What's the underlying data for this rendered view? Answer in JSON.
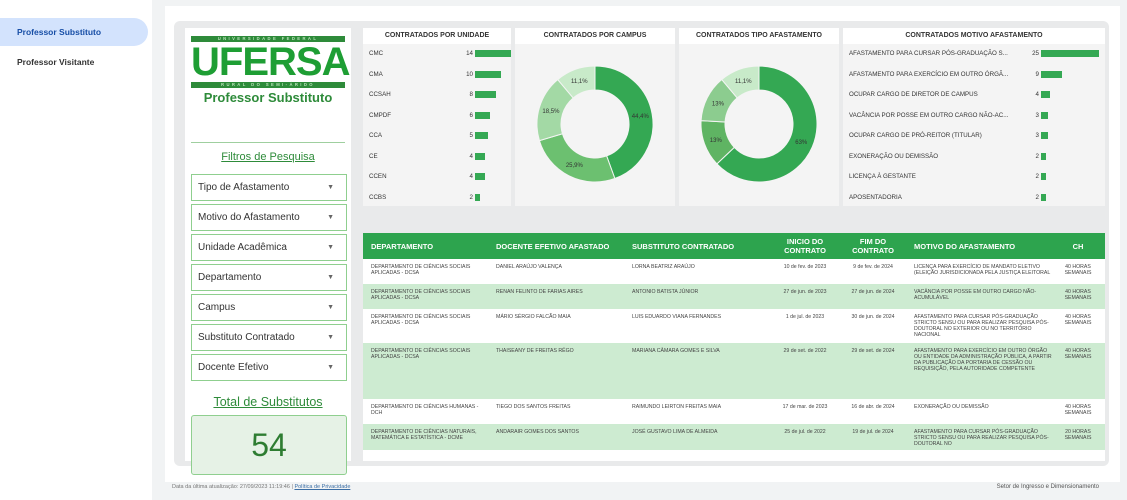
{
  "nav": {
    "items": [
      {
        "label": "Professor Substituto"
      },
      {
        "label": "Professor Visitante"
      }
    ]
  },
  "logo": {
    "top_band": "UNIVERSIDADE FEDERAL",
    "word": "UFERSA",
    "bottom_band": "RURAL DO SEMI-ÁRIDO"
  },
  "panel": {
    "title": "Professor Substituto",
    "filters_title": "Filtros de Pesquisa",
    "filters": [
      "Tipo de Afastamento",
      "Motivo do Afastamento",
      "Unidade Acadêmica",
      "Departamento",
      "Campus",
      "Substituto Contratado",
      "Docente Efetivo"
    ],
    "total_title": "Total de Substitutos",
    "total_value": "54"
  },
  "colors": {
    "accent": "#34a853",
    "header": "#2da44e",
    "row_alt": "#cdebd1"
  },
  "chart_data": [
    {
      "type": "bar",
      "title": "CONTRATADOS POR UNIDADE",
      "categories": [
        "CMC",
        "CMA",
        "CCSAH",
        "CMPDF",
        "CCA",
        "CE",
        "CCEN",
        "CCBS"
      ],
      "values": [
        14,
        10,
        8,
        6,
        5,
        4,
        4,
        2
      ]
    },
    {
      "type": "pie",
      "title": "CONTRATADOS POR CAMPUS",
      "values": [
        44.4,
        25.9,
        18.5,
        11.1
      ],
      "labels": [
        "44,4%",
        "25,9%",
        "18,5%",
        "11,1%"
      ],
      "colors": [
        "#34a853",
        "#6cc070",
        "#a3d9a5",
        "#c8eac9"
      ]
    },
    {
      "type": "pie",
      "title": "CONTRATADOS TIPO AFASTAMENTO",
      "values": [
        63,
        13,
        13,
        11.1
      ],
      "labels": [
        "63%",
        "13%",
        "13%",
        "11,1%"
      ],
      "colors": [
        "#34a853",
        "#5fb463",
        "#8ccc8f",
        "#c8eac9"
      ]
    },
    {
      "type": "bar",
      "title": "CONTRATADOS MOTIVO AFASTAMENTO",
      "categories": [
        "AFASTAMENTO PARA CURSAR PÓS-GRADUAÇÃO S...",
        "AFASTAMENTO PARA EXERCÍCIO EM OUTRO ÓRGÃ...",
        "OCUPAR CARGO DE DIRETOR DE CAMPUS",
        "VACÂNCIA POR POSSE EM OUTRO CARGO NÃO-AC...",
        "OCUPAR CARGO DE PRÓ-REITOR (TITULAR)",
        "EXONERAÇÃO OU DEMISSÃO",
        "LICENÇA À GESTANTE",
        "APOSENTADORIA"
      ],
      "values": [
        25,
        9,
        4,
        3,
        3,
        2,
        2,
        2
      ]
    }
  ],
  "table": {
    "headers": [
      "DEPARTAMENTO",
      "DOCENTE EFETIVO AFASTADO",
      "SUBSTITUTO CONTRATADO",
      "INICIO DO CONTRATO",
      "FIM DO CONTRATO",
      "MOTIVO DO AFASTAMENTO",
      "CH"
    ],
    "rows": [
      [
        "DEPARTAMENTO DE CIÊNCIAS SOCIAIS APLICADAS - DCSA",
        "DANIEL ARAÚJO VALENÇA",
        "LORNA BEATRIZ ARAÚJO",
        "10 de fev. de 2023",
        "9 de fev. de 2024",
        "LICENÇA PARA EXERCÍCIO DE MANDATO ELETIVO (ELEIÇÃO JURISDICIONADA PELA JUSTIÇA ELEITORAL",
        "40 HORAS SEMANAIS"
      ],
      [
        "DEPARTAMENTO DE CIÊNCIAS SOCIAIS APLICADAS - DCSA",
        "RENAN FELINTO DE FARIAS AIRES",
        "ANTONIO BATISTA JÚNIOR",
        "27 de jun. de 2023",
        "27 de jun. de 2024",
        "VACÂNCIA POR POSSE EM OUTRO CARGO NÃO-ACUMULÁVEL",
        "40 HORAS SEMANAIS"
      ],
      [
        "DEPARTAMENTO DE CIÊNCIAS SOCIAIS APLICADAS - DCSA",
        "MÁRIO SÉRGIO FALCÃO MAIA",
        "LUIS EDUARDO VIANA FERNANDES",
        "1 de jul. de 2023",
        "30 de jun. de 2024",
        "AFASTAMENTO PARA CURSAR PÓS-GRADUAÇÃO STRICTO SENSU OU PARA REALIZAR PESQUISA PÓS-DOUTORAL NO EXTERIOR OU NO TERRITÓRIO NACIONAL",
        "40 HORAS SEMANAIS"
      ],
      [
        "DEPARTAMENTO DE CIÊNCIAS SOCIAIS APLICADAS - DCSA",
        "THAISEANY DE FREITAS RÊGO",
        "MARIANA CÂMARA GOMES E SILVA",
        "29 de set. de 2022",
        "29 de set. de 2024",
        "AFASTAMENTO PARA EXERCÍCIO EM OUTRO ÓRGÃO OU ENTIDADE DA ADMINISTRAÇÃO PÚBLICA, A PARTIR DA PUBLICAÇÃO DA PORTARIA DE CESSÃO OU REQUISIÇÃO, PELA AUTORIDADE COMPETENTE",
        "40 HORAS SEMANAIS"
      ],
      [
        "DEPARTAMENTO DE CIÊNCIAS HUMANAS - DCH",
        "TIEGO DOS SANTOS FREITAS",
        "RAIMUNDO LEIRTON FREITAS MAIA",
        "17 de mar. de 2023",
        "16 de abr. de 2024",
        "EXONERAÇÃO OU DEMISSÃO",
        "40 HORAS SEMANAIS"
      ],
      [
        "DEPARTAMENTO DE CIÊNCIAS NATURAIS, MATEMÁTICA E ESTATÍSTICA - DCME",
        "ANDARAIR GOMES DOS SANTOS",
        "JOSÉ GUSTAVO LIMA DE ALMEIDA",
        "25 de jul. de 2022",
        "19 de jul. de 2024",
        "AFASTAMENTO PARA CURSAR PÓS-GRADUAÇÃO STRICTO SENSU OU PARA REALIZAR PESQUISA PÓS-DOUTORAL NO",
        "20 HORAS SEMANAIS"
      ]
    ]
  },
  "credit": "Setor de Ingresso e Dimensionamento",
  "footer": {
    "updated": "Data da última atualização: 27/09/2023 11:19:46",
    "sep": "|",
    "privacy": "Política de Privacidade"
  }
}
